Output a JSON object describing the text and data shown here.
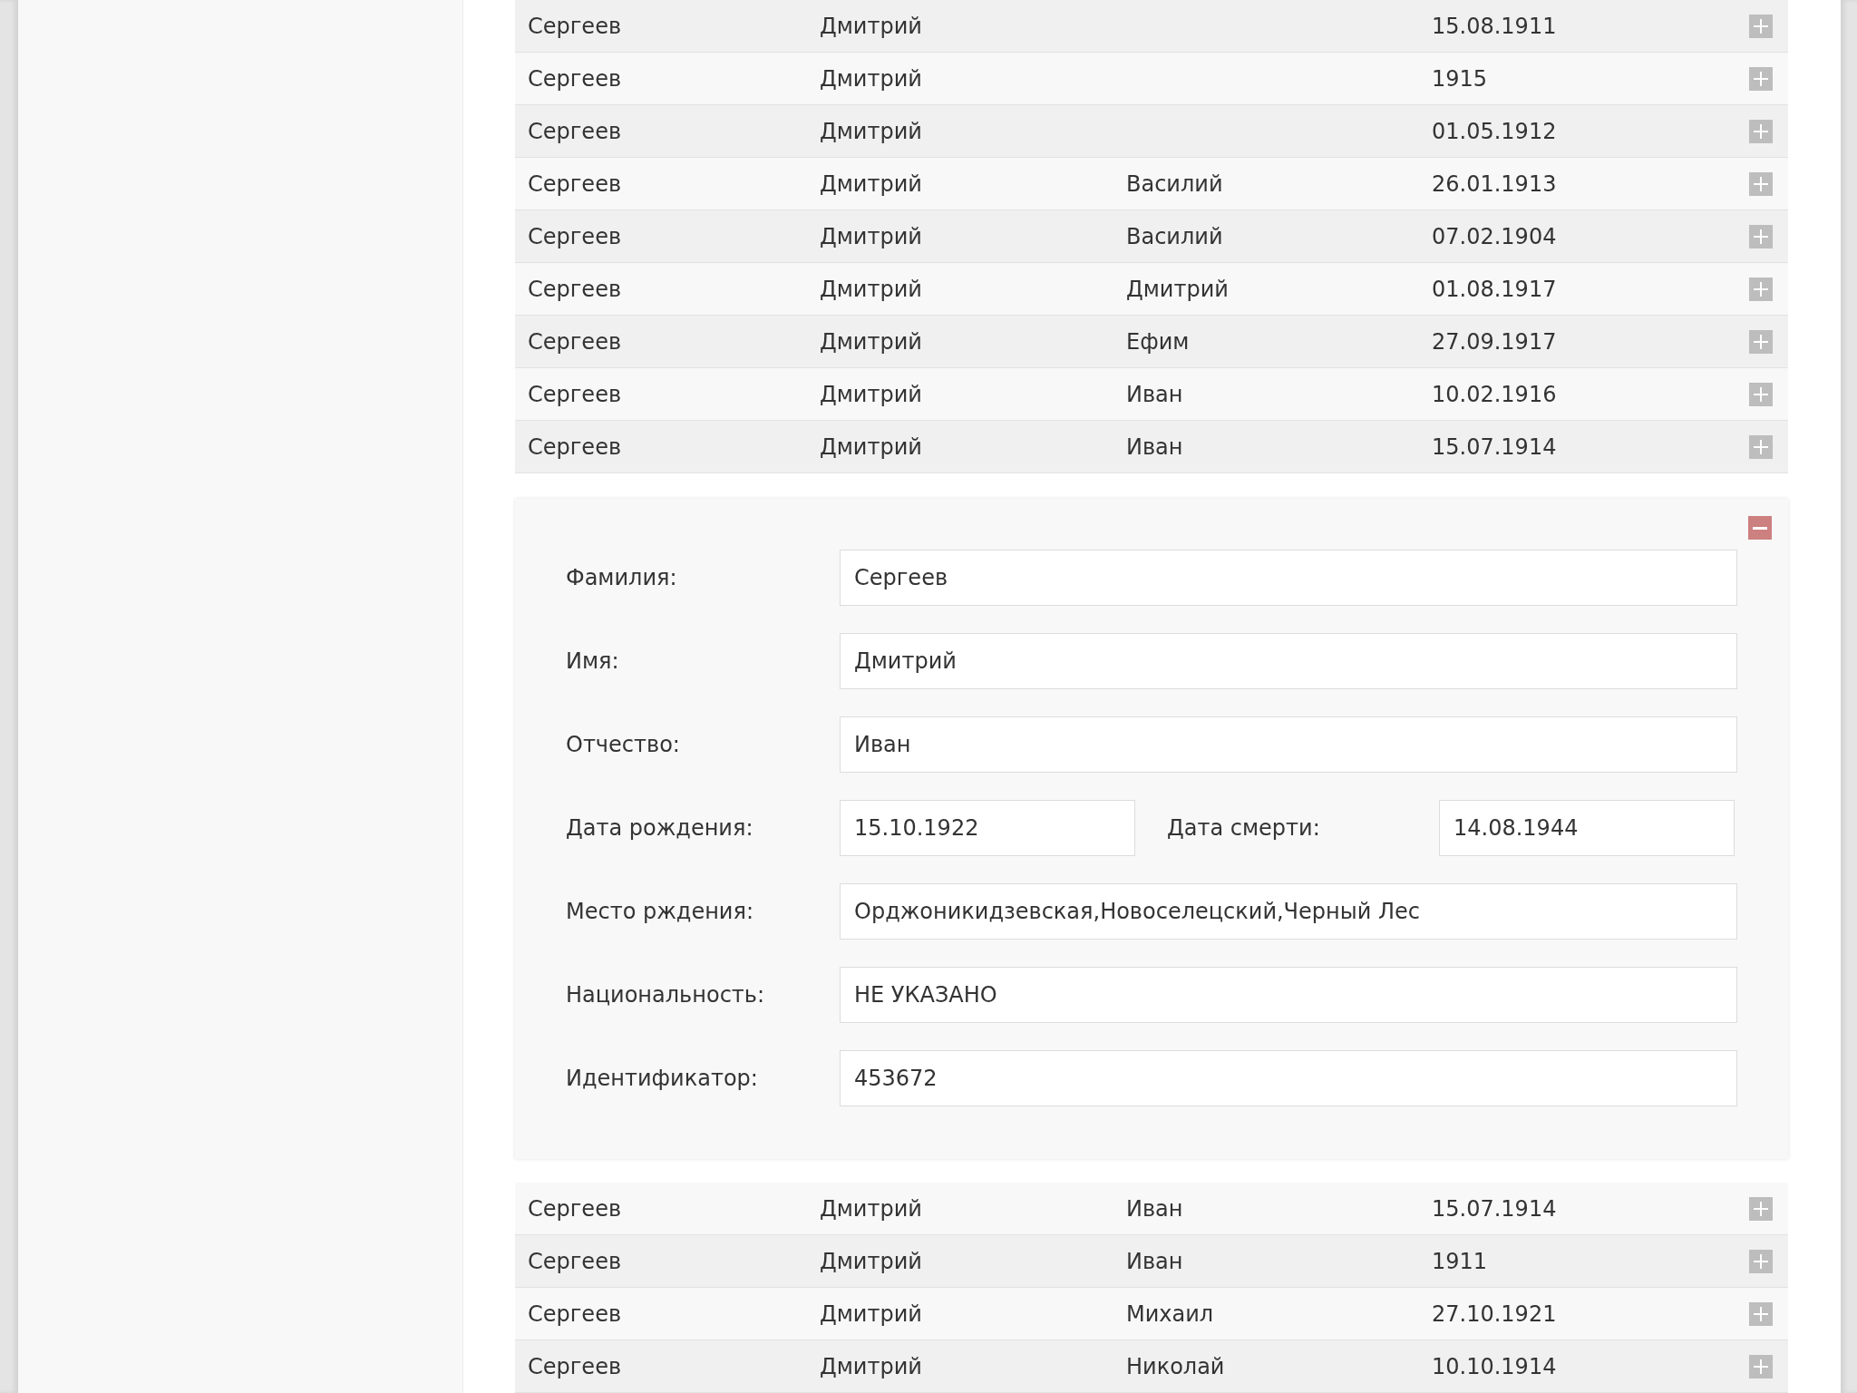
{
  "list": [
    {
      "kind": "row",
      "surname": "Сергеев",
      "name": "Дмитрий",
      "date": "15.08.1911",
      "expanded": false
    },
    {
      "kind": "row",
      "surname": "Сергеев",
      "name": "Дмитрий",
      "date": "1915",
      "expanded": false
    },
    {
      "kind": "row",
      "surname": "Сергеев",
      "name": "Дмитрий",
      "date": "01.05.1912",
      "expanded": false
    },
    {
      "kind": "row",
      "surname": "Сергеев",
      "name": "Дмитрий",
      "patronymic": "Василий",
      "date": "26.01.1913",
      "expanded": false
    },
    {
      "kind": "row",
      "surname": "Сергеев",
      "name": "Дмитрий",
      "patronymic": "Василий",
      "date": "07.02.1904",
      "expanded": false
    },
    {
      "kind": "row",
      "surname": "Сергеев",
      "name": "Дмитрий",
      "patronymic": "Дмитрий",
      "date": "01.08.1917",
      "expanded": false
    },
    {
      "kind": "row",
      "surname": "Сергеев",
      "name": "Дмитрий",
      "patronymic": "Ефим",
      "date": "27.09.1917",
      "expanded": false
    },
    {
      "kind": "row",
      "surname": "Сергеев",
      "name": "Дмитрий",
      "patronymic": "Иван",
      "date": "10.02.1916",
      "expanded": false
    },
    {
      "kind": "row",
      "surname": "Сергеев",
      "name": "Дмитрий",
      "patronymic": "Иван",
      "date": "15.07.1914",
      "expanded": false
    },
    {
      "kind": "detail",
      "expanded": true,
      "fields": [
        [
          {
            "label": "Фамилия:",
            "value": "Сергеев"
          }
        ],
        [
          {
            "label": "Имя:",
            "value": "Дмитрий"
          }
        ],
        [
          {
            "label": "Отчество:",
            "value": "Иван"
          }
        ],
        [
          {
            "label": "Дата рождения:",
            "value": "15.10.1922"
          },
          {
            "label": "Дата смерти:",
            "value": "14.08.1944"
          }
        ],
        [
          {
            "label": "Место рждения:",
            "value": "Орджоникидзевская,Новоселецский,Черный Лес"
          }
        ],
        [
          {
            "label": "Национальность:",
            "value": "НЕ УКАЗАНО"
          }
        ],
        [
          {
            "label": "Идентификатор:",
            "value": "453672"
          }
        ]
      ]
    },
    {
      "kind": "row",
      "surname": "Сергеев",
      "name": "Дмитрий",
      "patronymic": "Иван",
      "date": "15.07.1914",
      "expanded": false
    },
    {
      "kind": "row",
      "surname": "Сергеев",
      "name": "Дмитрий",
      "patronymic": "Иван",
      "date": "1911",
      "expanded": false
    },
    {
      "kind": "row",
      "surname": "Сергеев",
      "name": "Дмитрий",
      "patronymic": "Михаил",
      "date": "27.10.1921",
      "expanded": false
    },
    {
      "kind": "row",
      "surname": "Сергеев",
      "name": "Дмитрий",
      "patronymic": "Николай",
      "date": "10.10.1914",
      "expanded": false
    }
  ]
}
